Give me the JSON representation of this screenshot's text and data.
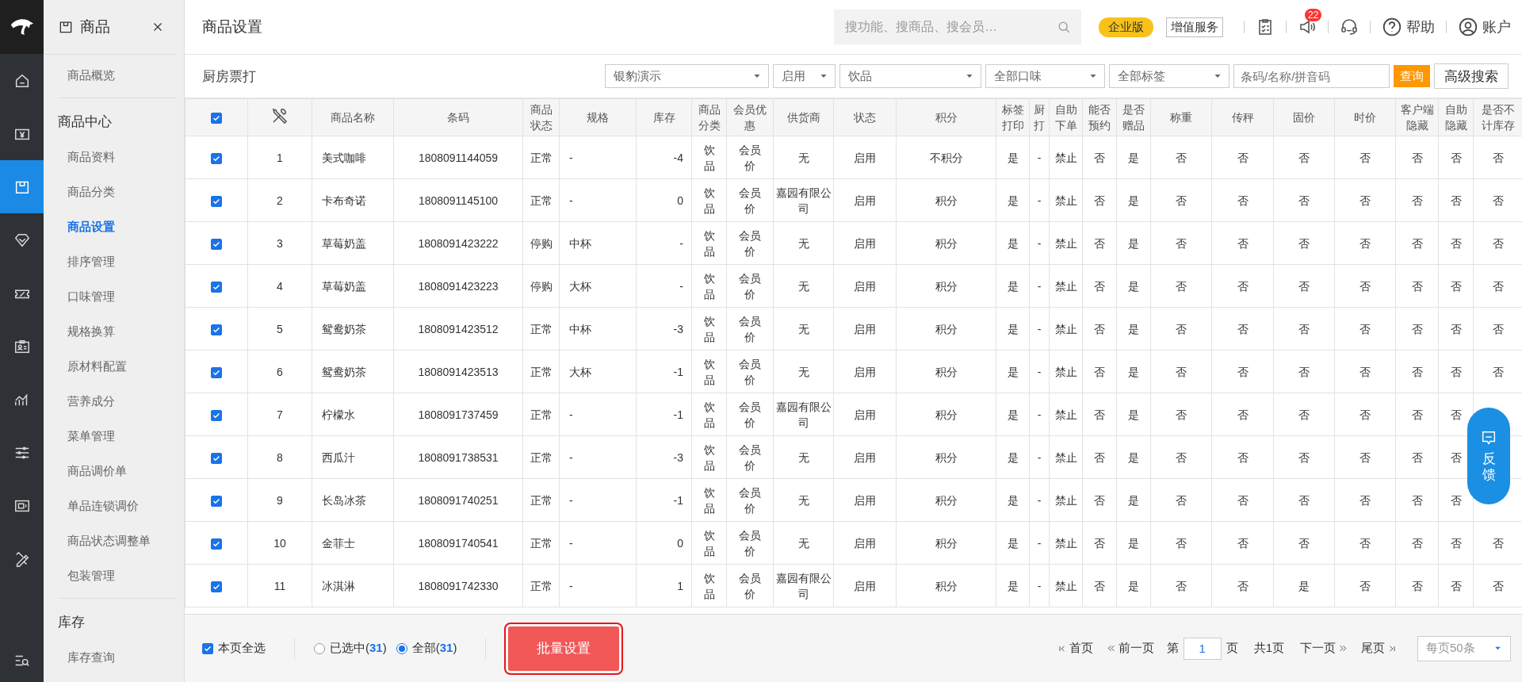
{
  "sidebar": {
    "rail": [
      {
        "selected": false
      },
      {
        "selected": false
      },
      {
        "selected": true
      },
      {
        "selected": false
      },
      {
        "selected": false
      },
      {
        "selected": false
      },
      {
        "selected": false
      },
      {
        "selected": false
      },
      {
        "selected": false
      },
      {
        "selected": false
      }
    ],
    "panel": {
      "title": "商品",
      "groups": [
        {
          "items": [
            {
              "label": "商品概览",
              "selected": false
            }
          ]
        },
        {
          "heading": "商品中心",
          "items": [
            {
              "label": "商品资料",
              "selected": false
            },
            {
              "label": "商品分类",
              "selected": false
            },
            {
              "label": "商品设置",
              "selected": true
            },
            {
              "label": "排序管理",
              "selected": false
            },
            {
              "label": "口味管理",
              "selected": false
            },
            {
              "label": "规格换算",
              "selected": false
            },
            {
              "label": "原材料配置",
              "selected": false
            },
            {
              "label": "营养成分",
              "selected": false
            },
            {
              "label": "菜单管理",
              "selected": false
            },
            {
              "label": "商品调价单",
              "selected": false
            },
            {
              "label": "单品连锁调价",
              "selected": false
            },
            {
              "label": "商品状态调整单",
              "selected": false
            },
            {
              "label": "包装管理",
              "selected": false
            }
          ]
        },
        {
          "heading": "库存",
          "items": [
            {
              "label": "库存查询",
              "selected": false
            }
          ]
        }
      ]
    }
  },
  "header": {
    "title": "商品设置",
    "search": {
      "placeholder": "搜功能、搜商品、搜会员…"
    },
    "edition": "企业版",
    "service": "增值服务",
    "notification_count": "22",
    "help": "帮助",
    "account": "账户"
  },
  "filter": {
    "label": "厨房票打",
    "selects": [
      "银豹演示",
      "启用",
      "饮品",
      "全部口味",
      "全部标签"
    ],
    "search": {
      "placeholder": "条码/名称/拼音码"
    },
    "query": "查询",
    "advanced": "高级搜索"
  },
  "table": {
    "all_checked": true,
    "columns": [
      "",
      "商品名称",
      "条码",
      "商品状态",
      "规格",
      "库存",
      "商品分类",
      "会员优惠",
      "供货商",
      "状态",
      "积分",
      "标签打印",
      "厨打",
      "自助下单",
      "能否预约",
      "是否赠品",
      "称重",
      "传秤",
      "固价",
      "时价",
      "客户端隐藏",
      "自助隐藏",
      "是否不计库存"
    ],
    "rows": [
      {
        "checked": true,
        "cells": [
          "1",
          "美式咖啡",
          "1808091144059",
          "正常",
          "-",
          "-4",
          "饮品",
          "会员价",
          "无",
          "启用",
          "不积分",
          "是",
          "-",
          "禁止",
          "否",
          "是",
          "否",
          "否",
          "否",
          "否",
          "否",
          "否",
          "否"
        ]
      },
      {
        "checked": true,
        "cells": [
          "2",
          "卡布奇诺",
          "1808091145100",
          "正常",
          "-",
          "0",
          "饮品",
          "会员价",
          "嘉园有限公司",
          "启用",
          "积分",
          "是",
          "-",
          "禁止",
          "否",
          "是",
          "否",
          "否",
          "否",
          "否",
          "否",
          "否",
          "否"
        ]
      },
      {
        "checked": true,
        "cells": [
          "3",
          "草莓奶盖",
          "1808091423222",
          "停购",
          "中杯",
          "-",
          "饮品",
          "会员价",
          "无",
          "启用",
          "积分",
          "是",
          "-",
          "禁止",
          "否",
          "是",
          "否",
          "否",
          "否",
          "否",
          "否",
          "否",
          "否"
        ]
      },
      {
        "checked": true,
        "cells": [
          "4",
          "草莓奶盖",
          "1808091423223",
          "停购",
          "大杯",
          "-",
          "饮品",
          "会员价",
          "无",
          "启用",
          "积分",
          "是",
          "-",
          "禁止",
          "否",
          "是",
          "否",
          "否",
          "否",
          "否",
          "否",
          "否",
          "否"
        ]
      },
      {
        "checked": true,
        "cells": [
          "5",
          "鸳鸯奶茶",
          "1808091423512",
          "正常",
          "中杯",
          "-3",
          "饮品",
          "会员价",
          "无",
          "启用",
          "积分",
          "是",
          "-",
          "禁止",
          "否",
          "是",
          "否",
          "否",
          "否",
          "否",
          "否",
          "否",
          "否"
        ]
      },
      {
        "checked": true,
        "cells": [
          "6",
          "鸳鸯奶茶",
          "1808091423513",
          "正常",
          "大杯",
          "-1",
          "饮品",
          "会员价",
          "无",
          "启用",
          "积分",
          "是",
          "-",
          "禁止",
          "否",
          "是",
          "否",
          "否",
          "否",
          "否",
          "否",
          "否",
          "否"
        ]
      },
      {
        "checked": true,
        "cells": [
          "7",
          "柠檬水",
          "1808091737459",
          "正常",
          "-",
          "-1",
          "饮品",
          "会员价",
          "嘉园有限公司",
          "启用",
          "积分",
          "是",
          "-",
          "禁止",
          "否",
          "是",
          "否",
          "否",
          "否",
          "否",
          "否",
          "否",
          ""
        ]
      },
      {
        "checked": true,
        "cells": [
          "8",
          "西瓜汁",
          "1808091738531",
          "正常",
          "-",
          "-3",
          "饮品",
          "会员价",
          "无",
          "启用",
          "积分",
          "是",
          "-",
          "禁止",
          "否",
          "是",
          "否",
          "否",
          "否",
          "否",
          "否",
          "否",
          ""
        ]
      },
      {
        "checked": true,
        "cells": [
          "9",
          "长岛冰茶",
          "1808091740251",
          "正常",
          "-",
          "-1",
          "饮品",
          "会员价",
          "无",
          "启用",
          "积分",
          "是",
          "-",
          "禁止",
          "否",
          "是",
          "否",
          "否",
          "否",
          "否",
          "否",
          "否",
          ""
        ]
      },
      {
        "checked": true,
        "cells": [
          "10",
          "金菲士",
          "1808091740541",
          "正常",
          "-",
          "0",
          "饮品",
          "会员价",
          "无",
          "启用",
          "积分",
          "是",
          "-",
          "禁止",
          "否",
          "是",
          "否",
          "否",
          "否",
          "否",
          "否",
          "否",
          "否"
        ]
      },
      {
        "checked": true,
        "cells": [
          "11",
          "冰淇淋",
          "1808091742330",
          "正常",
          "-",
          "1",
          "饮品",
          "会员价",
          "嘉园有限公司",
          "启用",
          "积分",
          "是",
          "-",
          "禁止",
          "否",
          "是",
          "否",
          "否",
          "是",
          "否",
          "否",
          "否",
          "否"
        ]
      }
    ]
  },
  "footer": {
    "page_all": {
      "label": "本页全选",
      "checked": true
    },
    "scope": [
      {
        "label": "已选中(**31**)",
        "selected": false
      },
      {
        "label": "全部(**31**)",
        "selected": true
      }
    ],
    "batch": "批量设置",
    "pager": {
      "first": "首页",
      "prev": "前一页",
      "page_pre": "第",
      "page": "1",
      "page_post": "页",
      "total": "共1页",
      "next": "下一页",
      "last": "尾页",
      "per_page": "每页50条"
    }
  },
  "feedback": {
    "label": "反馈"
  }
}
